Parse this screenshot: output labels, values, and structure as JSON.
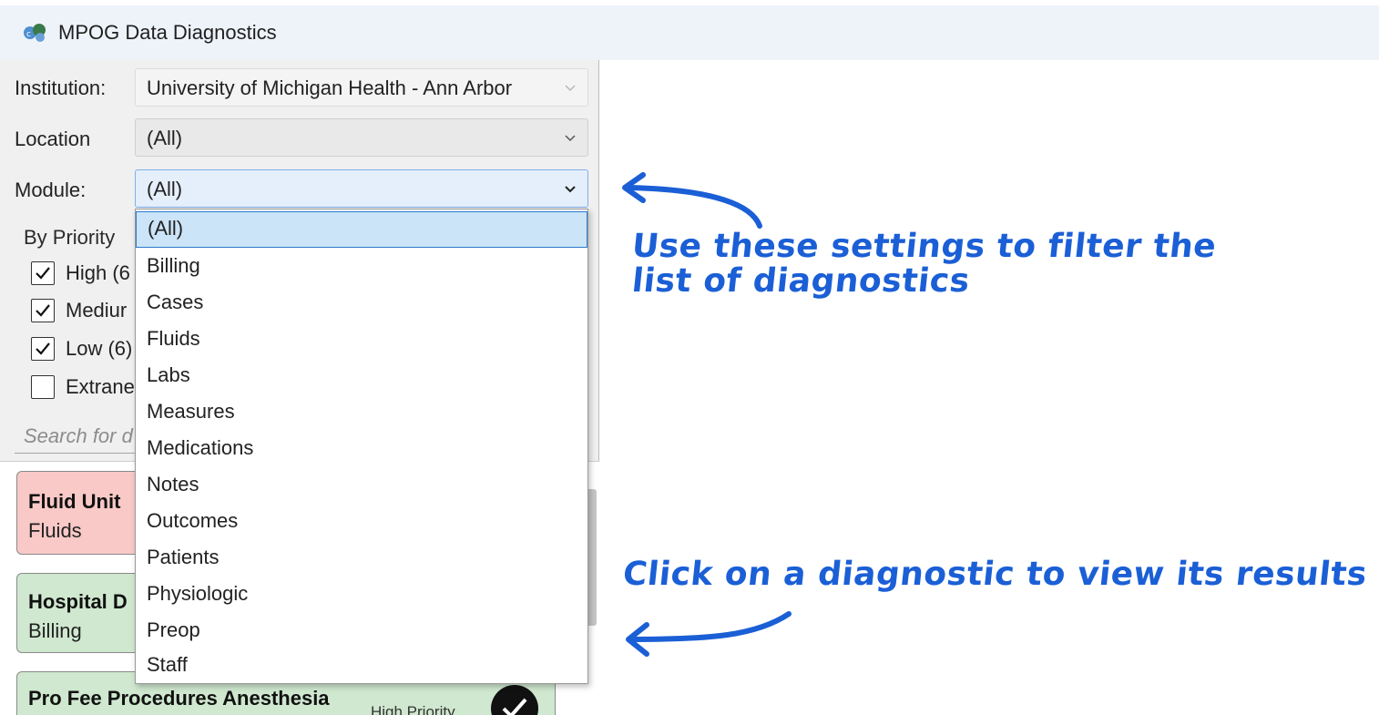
{
  "window": {
    "title": "MPOG Data Diagnostics",
    "app_icon": "mpog-logo-icon"
  },
  "filters": {
    "institution": {
      "label": "Institution:",
      "value": "University of Michigan Health - Ann Arbor"
    },
    "location": {
      "label": "Location",
      "value": "(All)"
    },
    "module": {
      "label": "Module:",
      "value": "(All)"
    }
  },
  "priority": {
    "label": "By Priority",
    "items": [
      {
        "label": "High (6",
        "checked": true
      },
      {
        "label": "Mediur",
        "checked": true
      },
      {
        "label": "Low (6)",
        "checked": true
      },
      {
        "label": "Extrane",
        "checked": false
      }
    ]
  },
  "search": {
    "placeholder": "Search for d"
  },
  "diagnostics": [
    {
      "title": "Fluid Unit",
      "module": "Fluids",
      "color": "#f8c9c7"
    },
    {
      "title": "Hospital D",
      "module": "Billing",
      "color": "#cfe8cf"
    },
    {
      "title": "Pro Fee Procedures Anesthesia",
      "priority": "High Priority",
      "color": "#cfe8cf"
    }
  ],
  "module_dropdown": {
    "selected": "(All)",
    "options": [
      "(All)",
      "Billing",
      "Cases",
      "Fluids",
      "Labs",
      "Measures",
      "Medications",
      "Notes",
      "Outcomes",
      "Patients",
      "Physiologic",
      "Preop",
      "Staff"
    ]
  },
  "annotations": {
    "filter_line1": "Use these settings to filter the",
    "filter_line2": "list of diagnostics",
    "click_hint": "Click on a diagnostic to view its results",
    "color": "#1b5fd6"
  }
}
